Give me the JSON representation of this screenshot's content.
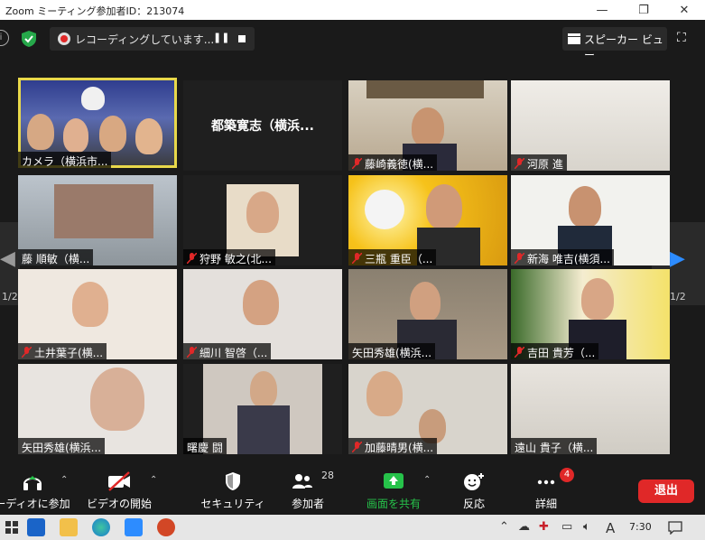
{
  "window": {
    "title": "Zoom ミーティング参加者ID：213074",
    "minimize": "—",
    "restore": "❐",
    "close": "✕"
  },
  "topbar": {
    "recording_label": "レコーディングしています...",
    "speaker_view_label": "スピーカー ビュー",
    "accent_green": "#26a84a"
  },
  "pager": {
    "left_page": "1/2",
    "right_page": "1/2",
    "arrow_color": "#2d8cff"
  },
  "participants": [
    {
      "name": "カメラ（横浜市...",
      "muted": false,
      "active": true
    },
    {
      "name": "都築寛志（横浜...",
      "muted": false,
      "video": false
    },
    {
      "name": "藤崎義徳(横...",
      "muted": true
    },
    {
      "name": "河原 進",
      "muted": true
    },
    {
      "name": "藤 順敏（横...",
      "muted": false
    },
    {
      "name": "狩野 敏之(北...",
      "muted": true
    },
    {
      "name": "三瓶 重臣（...",
      "muted": true
    },
    {
      "name": "新海 唯吉(横須...",
      "muted": true
    },
    {
      "name": "土井葉子(横...",
      "muted": true
    },
    {
      "name": "細川 智啓（...",
      "muted": true
    },
    {
      "name": "矢田秀雄(横浜...",
      "muted": false
    },
    {
      "name": "吉田 貴芳（...",
      "muted": true
    },
    {
      "name": "矢田秀雄(横浜...",
      "muted": false
    },
    {
      "name": "曙慶 闘",
      "muted": false
    },
    {
      "name": "加藤晴男(横...",
      "muted": true
    },
    {
      "name": "遠山 貴子（横...",
      "muted": false
    }
  ],
  "toolbar": {
    "audio_label": "ーディオに参加",
    "video_label": "ビデオの開始",
    "security_label": "セキュリティ",
    "participants_label": "参加者",
    "participants_count": "28",
    "share_label": "画面を共有",
    "reactions_label": "反応",
    "more_label": "詳細",
    "more_badge": "4",
    "exit_label": "退出",
    "share_color": "#26c24a",
    "exit_color": "#e02828"
  },
  "taskbar": {
    "time": "7:30",
    "ime": "A"
  }
}
